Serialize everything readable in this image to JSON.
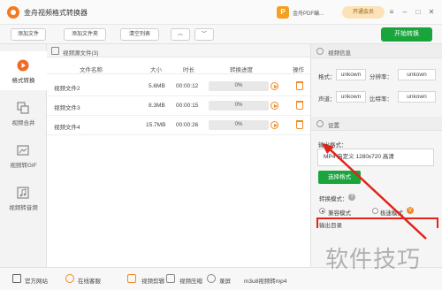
{
  "app": {
    "title": "金舟视频格式转换器",
    "promo_text": "金舟PDF编...",
    "vip_label": "开通会员",
    "promo_icon_glyph": "P"
  },
  "window_controls": {
    "menu": "≡",
    "minimize": "–",
    "maximize": "□",
    "close": "✕"
  },
  "toolbar": {
    "add_file": "添加文件",
    "add_folder": "添加文件夹",
    "clear_list": "清空列表",
    "up": "︿",
    "down": "﹀",
    "start": "开始转换"
  },
  "sidebar": {
    "items": [
      {
        "label": "格式转换",
        "icon": "convert-icon",
        "active": true
      },
      {
        "label": "视频合并",
        "icon": "merge-icon",
        "active": false
      },
      {
        "label": "视频转GIF",
        "icon": "gif-icon",
        "active": false
      },
      {
        "label": "视频转音频",
        "icon": "audio-icon",
        "active": false
      }
    ]
  },
  "file_list": {
    "header": "视频源文件(3)",
    "columns": [
      "文件名称",
      "大小",
      "时长",
      "转换进度",
      "操作"
    ],
    "rows": [
      {
        "name": "视频文件2",
        "size": "5.6MB",
        "duration": "00:00:12",
        "progress": "0%"
      },
      {
        "name": "视频文件3",
        "size": "8.3MB",
        "duration": "00:00:15",
        "progress": "0%"
      },
      {
        "name": "视频文件4",
        "size": "15.7MB",
        "duration": "00:00:26",
        "progress": "0%"
      }
    ]
  },
  "video_info": {
    "title": "视频信息",
    "format_label": "格式：",
    "format_value": "unkown",
    "resolution_label": "分辨率：",
    "resolution_value": "unkown",
    "channel_label": "声道：",
    "channel_value": "unkown",
    "bitrate_label": "比特率：",
    "bitrate_value": "unkown"
  },
  "settings": {
    "title": "设置",
    "output_format_label": "输出格式：",
    "output_format_value": "MP4 自定义 1280x720 高清",
    "select_format_button": "选择格式",
    "mode_label": "转换模式：",
    "help_glyph": "?",
    "compatible_mode": "兼容模式",
    "fast_mode": "极速模式",
    "fast_badge": "V",
    "output_dir_label": "输出目录"
  },
  "footer": {
    "website": "官方网站",
    "service": "在线客服",
    "video_edit": "视频剪辑",
    "video_compress": "视频压缩",
    "record": "录屏",
    "m3u8": "m3u8视频转mp4"
  },
  "watermark": "软件技巧",
  "colors": {
    "accent_green": "#19a53c",
    "accent_orange": "#f08a24",
    "highlight_red": "#e2231a"
  }
}
